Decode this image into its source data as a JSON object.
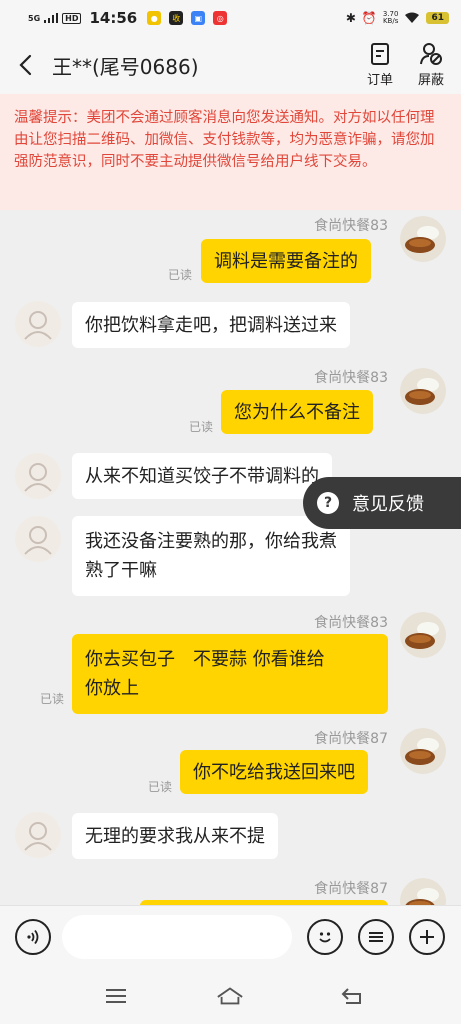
{
  "status_bar": {
    "signal": "5G",
    "hd": "HD",
    "time": "14:56",
    "speed_value": "3.70",
    "speed_unit": "KB/s",
    "battery": "61"
  },
  "header": {
    "title": "王**(尾号0686)",
    "order_label": "订单",
    "block_label": "屏蔽"
  },
  "notice": {
    "text": "温馨提示：美团不会通过顾客消息向您发送通知。对方如以任何理由让您扫描二维码、加微信、支付钱款等，均为恶意诈骗，请您加强防范意识，同时不要主动提供微信号给用户线下交易。"
  },
  "messages": [
    {
      "side": "right",
      "sender": "食尚快餐83",
      "text": "调料是需要备注的",
      "read": "已读"
    },
    {
      "side": "left",
      "text": "你把饮料拿走吧，把调料送过来"
    },
    {
      "side": "right",
      "sender": "食尚快餐83",
      "text": "您为什么不备注",
      "read": "已读"
    },
    {
      "side": "left",
      "text": "从来不知道买饺子不带调料的"
    },
    {
      "side": "left",
      "line1": "我还没备注要熟的那，你给我煮",
      "line2": "熟了干嘛"
    },
    {
      "side": "right",
      "sender": "食尚快餐83",
      "line1": "你去买包子　不要蒜  你看谁给",
      "line2": "你放上",
      "read": "已读"
    },
    {
      "side": "right",
      "sender": "食尚快餐87",
      "text": "你不吃给我送回来吧",
      "read": "已读"
    },
    {
      "side": "left",
      "text": "无理的要求我从来不提"
    },
    {
      "side": "right",
      "sender": "食尚快餐87",
      "text": ""
    }
  ],
  "feedback": {
    "icon": "?",
    "label": "意见反馈"
  },
  "colors": {
    "bubble_self": "#ffd400",
    "notice_bg": "#fde9e6",
    "notice_text": "#e0473a"
  }
}
